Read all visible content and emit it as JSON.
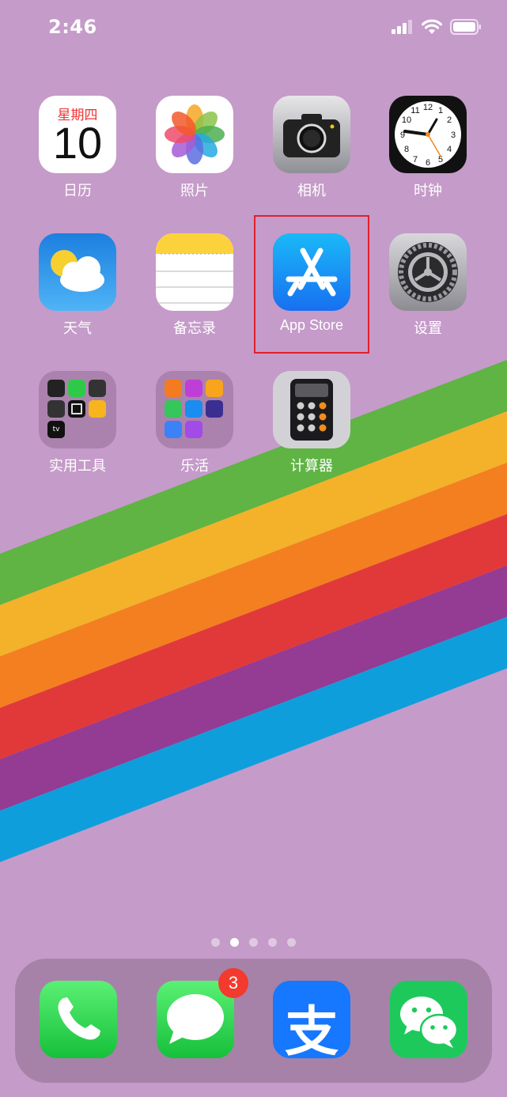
{
  "status_bar": {
    "time": "2:46"
  },
  "home": {
    "apps": [
      {
        "name": "calendar",
        "label": "日历",
        "weekday": "星期四",
        "day": "10"
      },
      {
        "name": "photos",
        "label": "照片"
      },
      {
        "name": "camera",
        "label": "相机"
      },
      {
        "name": "clock",
        "label": "时钟",
        "clock_numbers": [
          "12",
          "1",
          "2",
          "3",
          "4",
          "5",
          "6",
          "7",
          "8",
          "9",
          "10",
          "11"
        ]
      },
      {
        "name": "weather",
        "label": "天气"
      },
      {
        "name": "notes",
        "label": "备忘录"
      },
      {
        "name": "app-store",
        "label": "App Store",
        "highlighted": true
      },
      {
        "name": "settings",
        "label": "设置"
      },
      {
        "name": "utilities-folder",
        "label": "实用工具",
        "tv_text": "tv"
      },
      {
        "name": "entertainment-folder",
        "label": "乐活"
      },
      {
        "name": "calculator",
        "label": "计算器"
      }
    ],
    "page_dots": {
      "count": 5,
      "active_index": 1
    }
  },
  "dock": {
    "apps": [
      {
        "name": "phone",
        "icon": "phone-icon"
      },
      {
        "name": "messages",
        "icon": "messages-icon",
        "badge": "3"
      },
      {
        "name": "alipay",
        "icon": "alipay-icon",
        "glyph": "支"
      },
      {
        "name": "wechat",
        "icon": "wechat-icon"
      }
    ]
  },
  "colors": {
    "wallpaper": "#c59bc9",
    "stripes": [
      "#5fb443",
      "#f3b229",
      "#f47f20",
      "#e1393a",
      "#943b93",
      "#0f9edc"
    ],
    "highlight_box": "#e0202a"
  }
}
